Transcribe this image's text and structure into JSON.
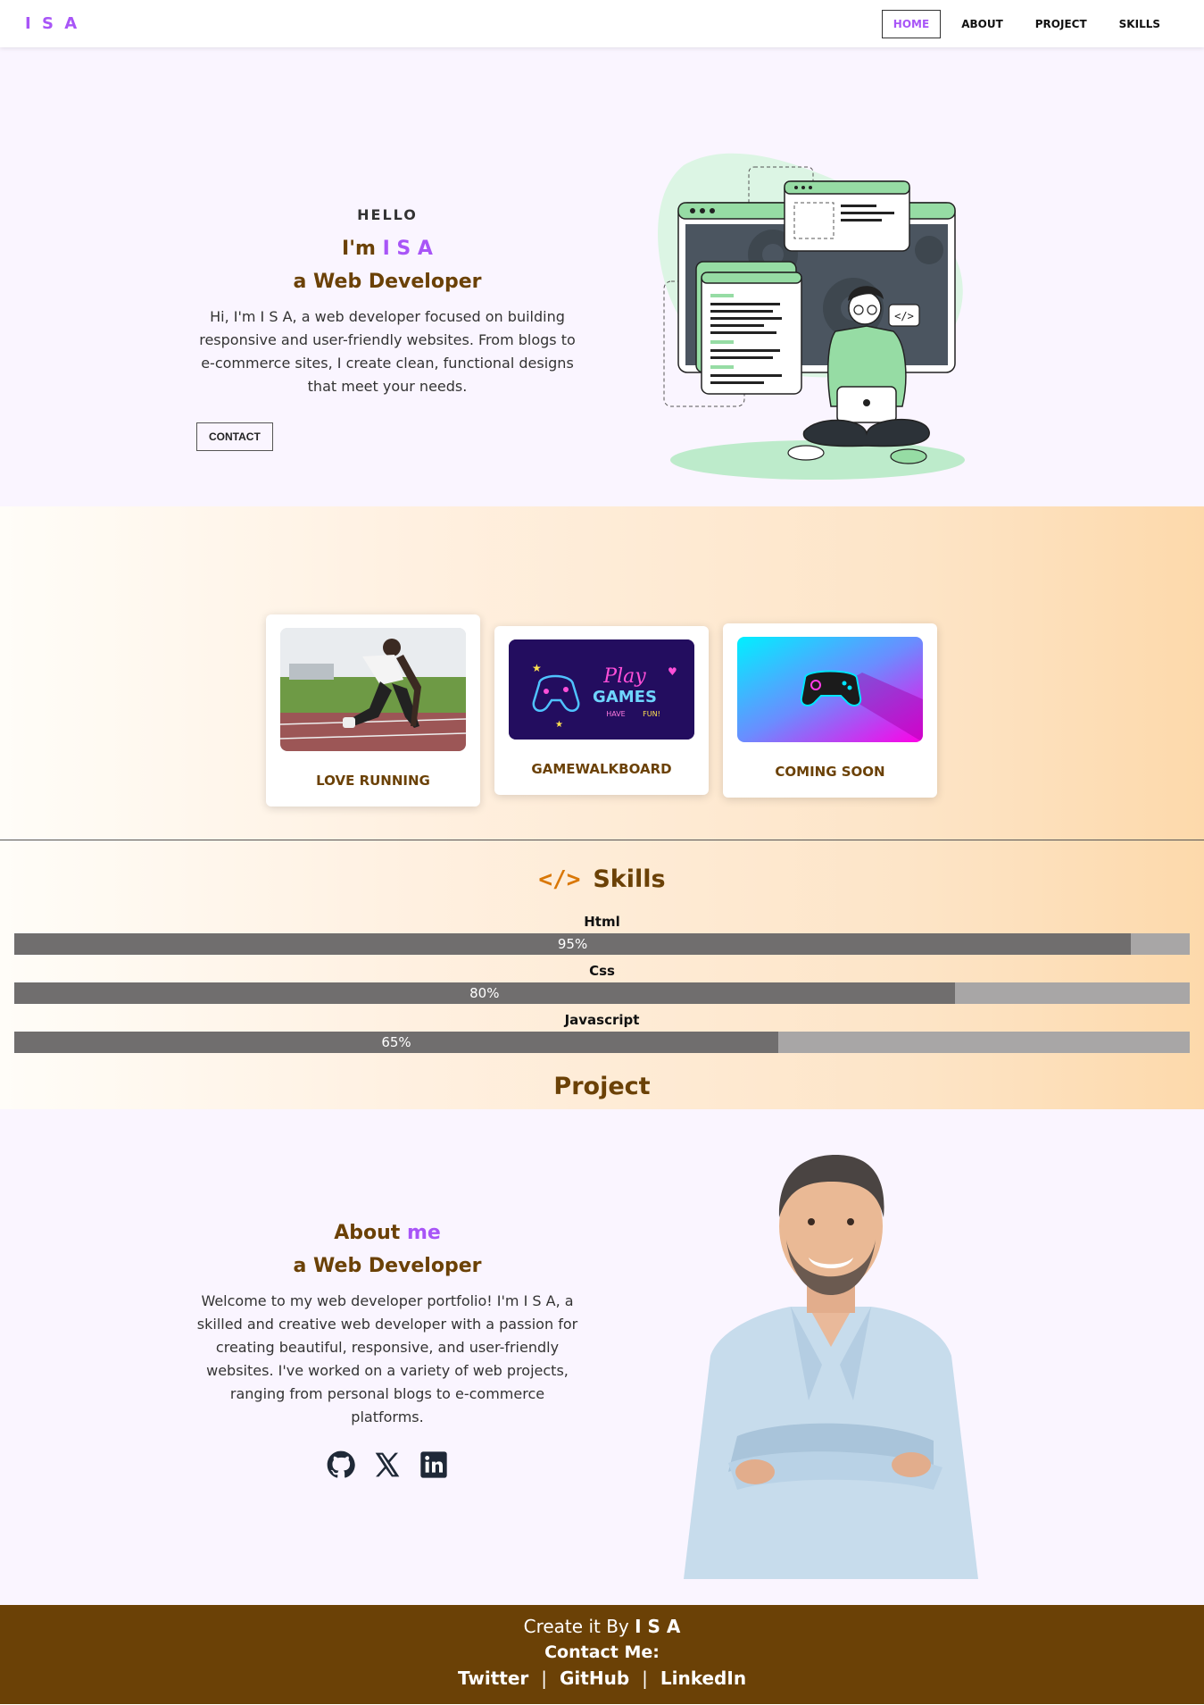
{
  "nav": {
    "logo": "I S A",
    "links": [
      "HOME",
      "ABOUT",
      "PROJECT",
      "SKILLS"
    ],
    "active": "HOME"
  },
  "hero": {
    "hello": "HELLO",
    "im": "I'm",
    "name": "I S A",
    "role": "a Web Developer",
    "description": "Hi, I'm I S A, a web developer focused on building responsive and user-friendly websites. From blogs to e-commerce sites, I create clean, functional designs that meet your needs.",
    "contact_button": "CONTACT"
  },
  "projects": {
    "title": "Project",
    "items": [
      {
        "label": "LOVE RUNNING",
        "image": "runner-photo"
      },
      {
        "label": "GAMEWALKBOARD",
        "image": "neon-play-games"
      },
      {
        "label": "COMING SOON",
        "image": "gamepad-gradient"
      }
    ]
  },
  "skills": {
    "title": "Skills",
    "icon": "code-icon",
    "items": [
      {
        "name": "Html",
        "percent": 95,
        "label": "95%"
      },
      {
        "name": "Css",
        "percent": 80,
        "label": "80%"
      },
      {
        "name": "Javascript",
        "percent": 65,
        "label": "65%"
      }
    ]
  },
  "about": {
    "title_part1": "About",
    "title_part2": "me",
    "role": "a Web Developer",
    "description": "Welcome to my web developer portfolio! I'm I S A, a skilled and creative web developer with a passion for creating beautiful, responsive, and user-friendly websites. I've worked on a variety of web projects, ranging from personal blogs to e-commerce platforms.",
    "socials": [
      "github-icon",
      "x-icon",
      "linkedin-icon"
    ]
  },
  "footer": {
    "created_prefix": "Create it By",
    "created_name": "I S A",
    "contact": "Contact Me:",
    "links": [
      "Twitter",
      "GitHub",
      "LinkedIn"
    ],
    "separator": "|"
  },
  "colors": {
    "accent": "#a855f7",
    "brown": "#6b4106",
    "footer_bg": "#6b4106",
    "bar_fill": "#706e6e",
    "bar_track": "#a8a6a6"
  }
}
